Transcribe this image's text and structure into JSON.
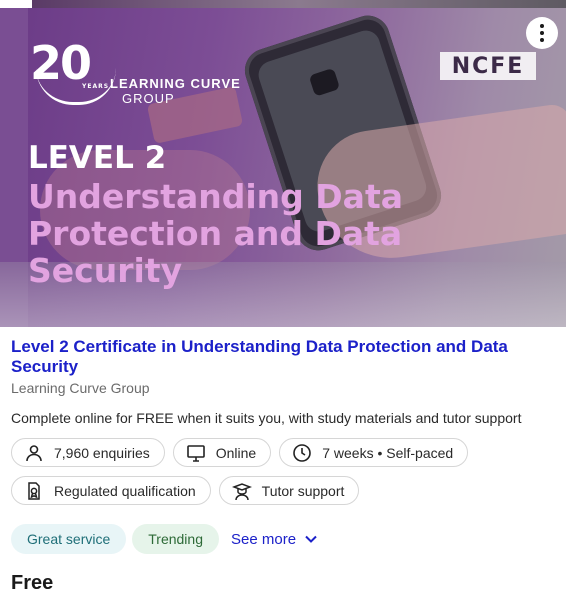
{
  "banner": {
    "logo_number": "20",
    "logo_years": "YEARS",
    "logo_name": "LEARNING CURVE",
    "logo_group": "GROUP",
    "partner_logo": "NCFE",
    "level_text": "LEVEL 2",
    "headline": "Understanding Data Protection and Data Security",
    "menu_icon": "more-vertical-icon"
  },
  "course": {
    "title": "Level 2 Certificate in Understanding Data Protection and Data Security",
    "provider": "Learning Curve Group",
    "description": "Complete online for FREE when it suits you, with study materials and tutor support"
  },
  "chips_row1": [
    {
      "icon": "person-icon",
      "label": "7,960 enquiries"
    },
    {
      "icon": "monitor-icon",
      "label": "Online"
    },
    {
      "icon": "clock-icon",
      "label": "7 weeks • Self-paced"
    }
  ],
  "chips_row2": [
    {
      "icon": "certificate-icon",
      "label": "Regulated qualification"
    },
    {
      "icon": "tutor-icon",
      "label": "Tutor support"
    }
  ],
  "tags": {
    "service": "Great service",
    "trending": "Trending",
    "see_more": "See more"
  },
  "price": "Free",
  "colors": {
    "link_blue": "#1c21c9",
    "banner_purple": "#7a4e93",
    "headline_pink": "#e2a3e0"
  }
}
